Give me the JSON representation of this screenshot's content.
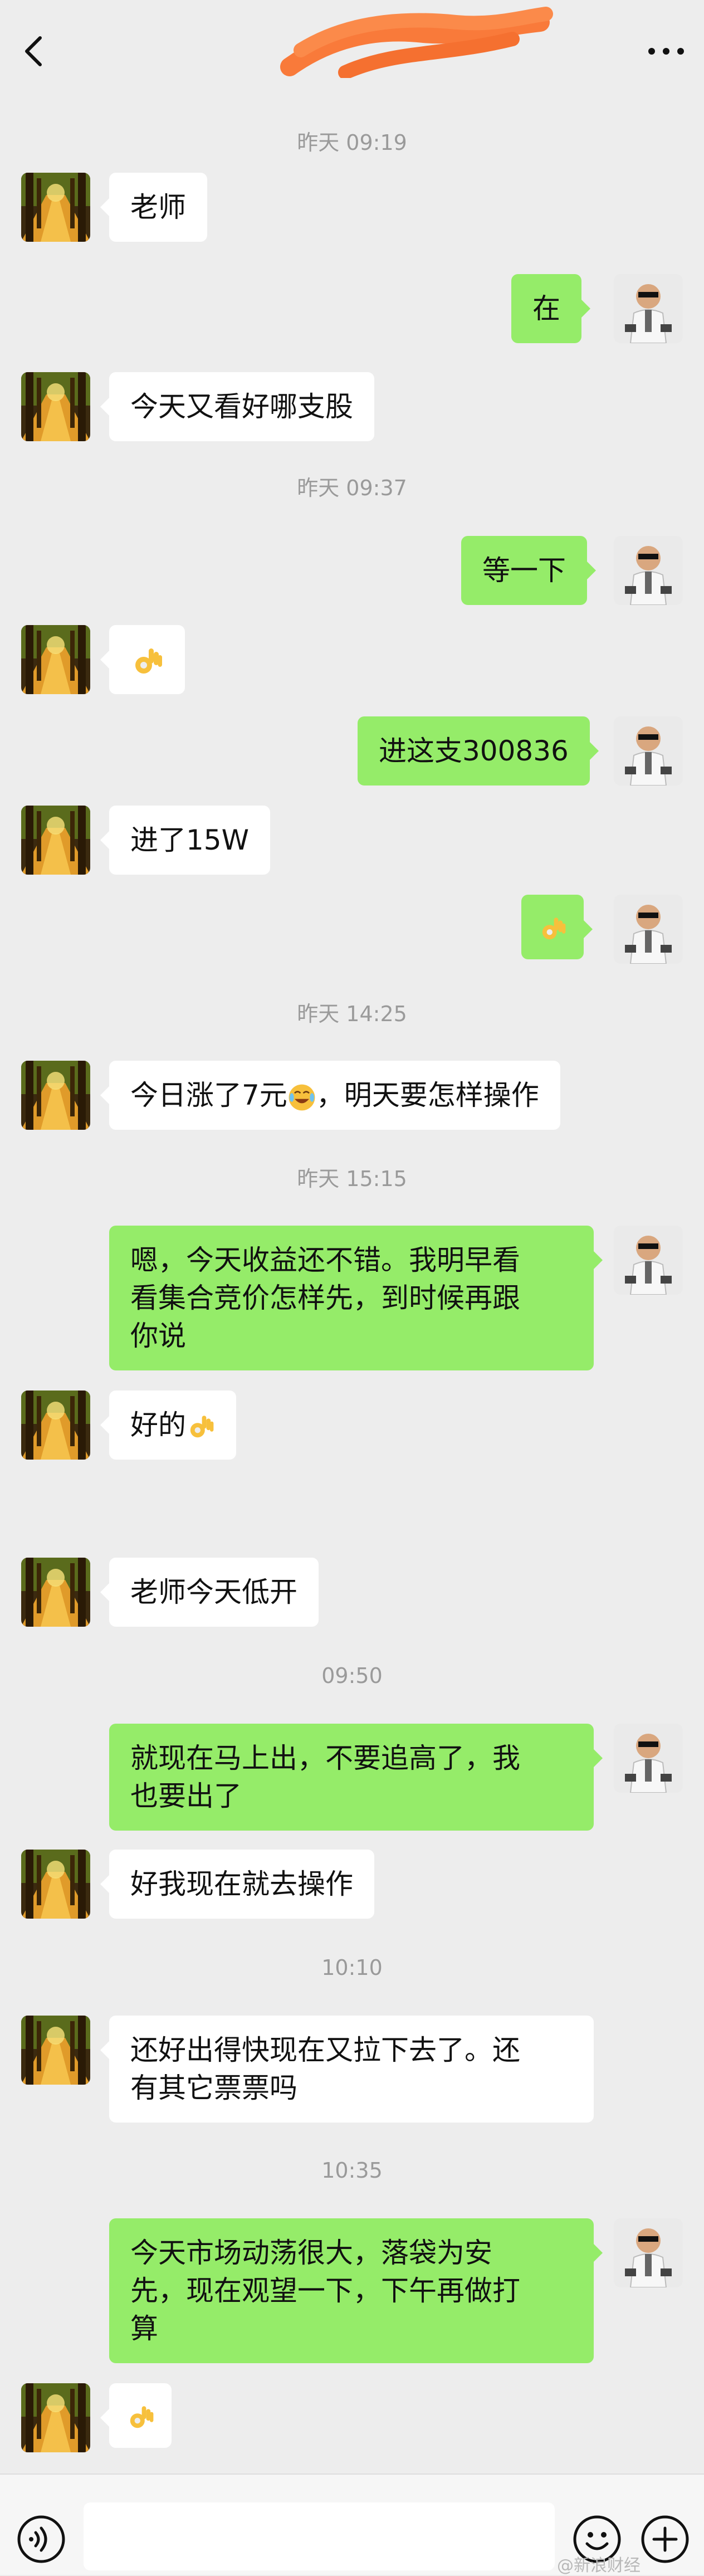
{
  "header": {
    "back_icon": "chevron-left-icon",
    "more_icon": "ellipsis-icon"
  },
  "messages": [
    {
      "type": "time",
      "text": "昨天 09:19"
    },
    {
      "type": "in",
      "text": "老师"
    },
    {
      "type": "out",
      "text": "在"
    },
    {
      "type": "in",
      "text": "今天又看好哪支股"
    },
    {
      "type": "time",
      "text": "昨天 09:37"
    },
    {
      "type": "out",
      "text": "等一下"
    },
    {
      "type": "in",
      "emoji": "ok-hand-emoji"
    },
    {
      "type": "out",
      "text": "进这支300836"
    },
    {
      "type": "in",
      "text": "进了15W"
    },
    {
      "type": "out",
      "emoji": "ok-hand-emoji"
    },
    {
      "type": "time",
      "text": "昨天 14:25"
    },
    {
      "type": "in",
      "text_before": "今日涨了7元",
      "emoji": "laughing-tears-emoji",
      "text_after": "，明天要怎样操作"
    },
    {
      "type": "time",
      "text": "昨天 15:15"
    },
    {
      "type": "out",
      "lines": [
        "嗯，今天收益还不错。我明早看",
        "看集合竞价怎样先，到时候再跟",
        "你说"
      ]
    },
    {
      "type": "in",
      "text_before": "好的",
      "emoji": "ok-hand-emoji"
    },
    {
      "type": "in",
      "text": "老师今天低开"
    },
    {
      "type": "time",
      "text": "09:50"
    },
    {
      "type": "out",
      "lines": [
        "就现在马上出，不要追高了，我",
        "也要出了"
      ]
    },
    {
      "type": "in",
      "text": "好我现在就去操作"
    },
    {
      "type": "time",
      "text": "10:10"
    },
    {
      "type": "in",
      "lines": [
        "还好出得快现在又拉下去了。还",
        "有其它票票吗"
      ]
    },
    {
      "type": "time",
      "text": "10:35"
    },
    {
      "type": "out",
      "lines": [
        "今天市场动荡很大，落袋为安",
        "先，现在观望一下，下午再做打",
        "算"
      ]
    },
    {
      "type": "in",
      "emoji": "ok-hand-emoji"
    }
  ],
  "footer": {
    "voice_icon": "voice-icon",
    "emoji_icon": "smiley-icon",
    "plus_icon": "plus-icon"
  },
  "watermark": "@新浪财经"
}
